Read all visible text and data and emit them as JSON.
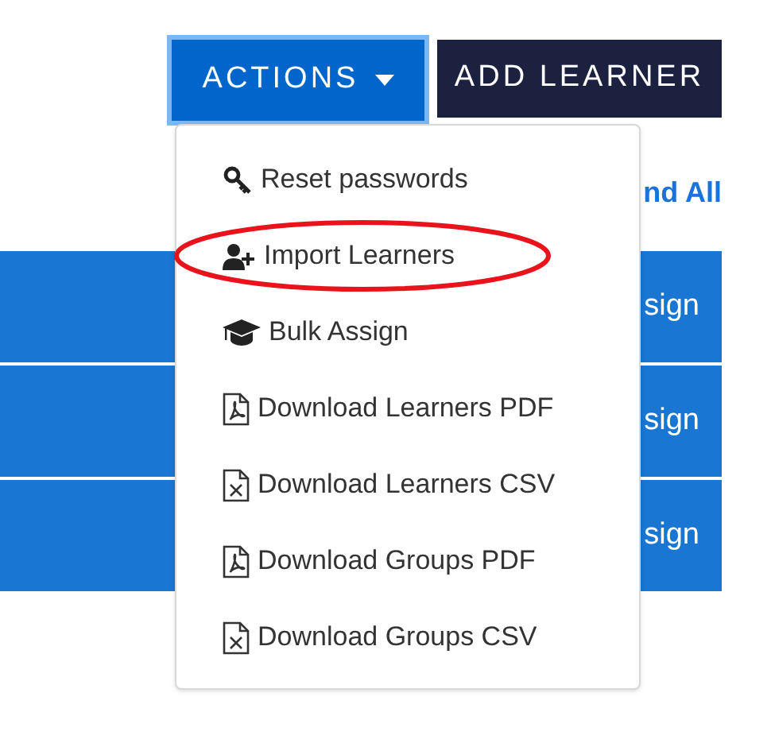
{
  "toolbar": {
    "actions_button": {
      "label": "ACTIONS",
      "focused": true,
      "expanded": true
    },
    "add_button": {
      "label": "ADD LEARNER"
    }
  },
  "link": "nd All",
  "rows": [
    {
      "action": "sign"
    },
    {
      "action": "sign"
    },
    {
      "action": "sign"
    }
  ],
  "menu": {
    "items": [
      {
        "label": "Reset passwords",
        "circled": false
      },
      {
        "label": "Import Learners",
        "circled": true
      },
      {
        "label": "Bulk Assign",
        "circled": false
      },
      {
        "label": "Download Learners PDF",
        "circled": false
      },
      {
        "label": "Download Learners CSV",
        "circled": false
      },
      {
        "label": "Download Groups PDF",
        "circled": false
      },
      {
        "label": "Download Groups CSV",
        "circled": false
      }
    ]
  }
}
